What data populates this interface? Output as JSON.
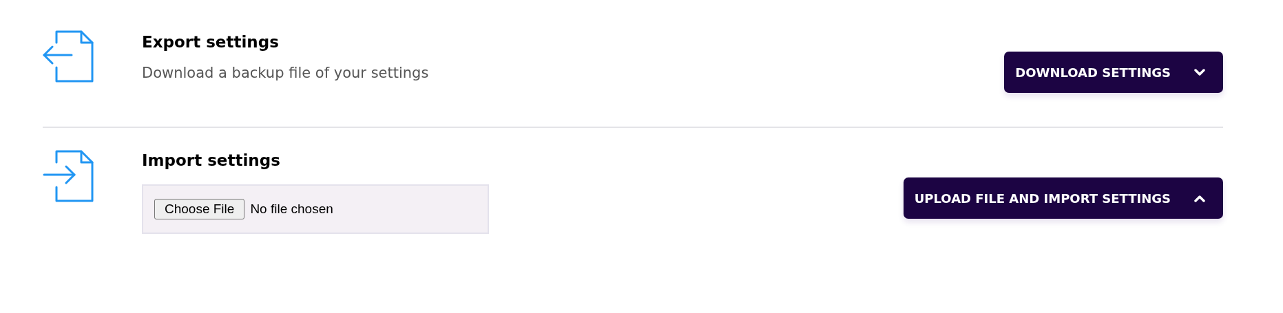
{
  "sections": [
    {
      "kind": "export",
      "title": "Export settings",
      "description": "Download a backup file of your settings",
      "button": {
        "label": "DOWNLOAD SETTINGS",
        "expanded": false
      }
    },
    {
      "kind": "import",
      "title": "Import settings",
      "file_input": {
        "button": "Choose File",
        "status": "No file chosen"
      },
      "button": {
        "label": "UPLOAD FILE AND IMPORT SETTINGS",
        "expanded": true
      }
    }
  ]
}
